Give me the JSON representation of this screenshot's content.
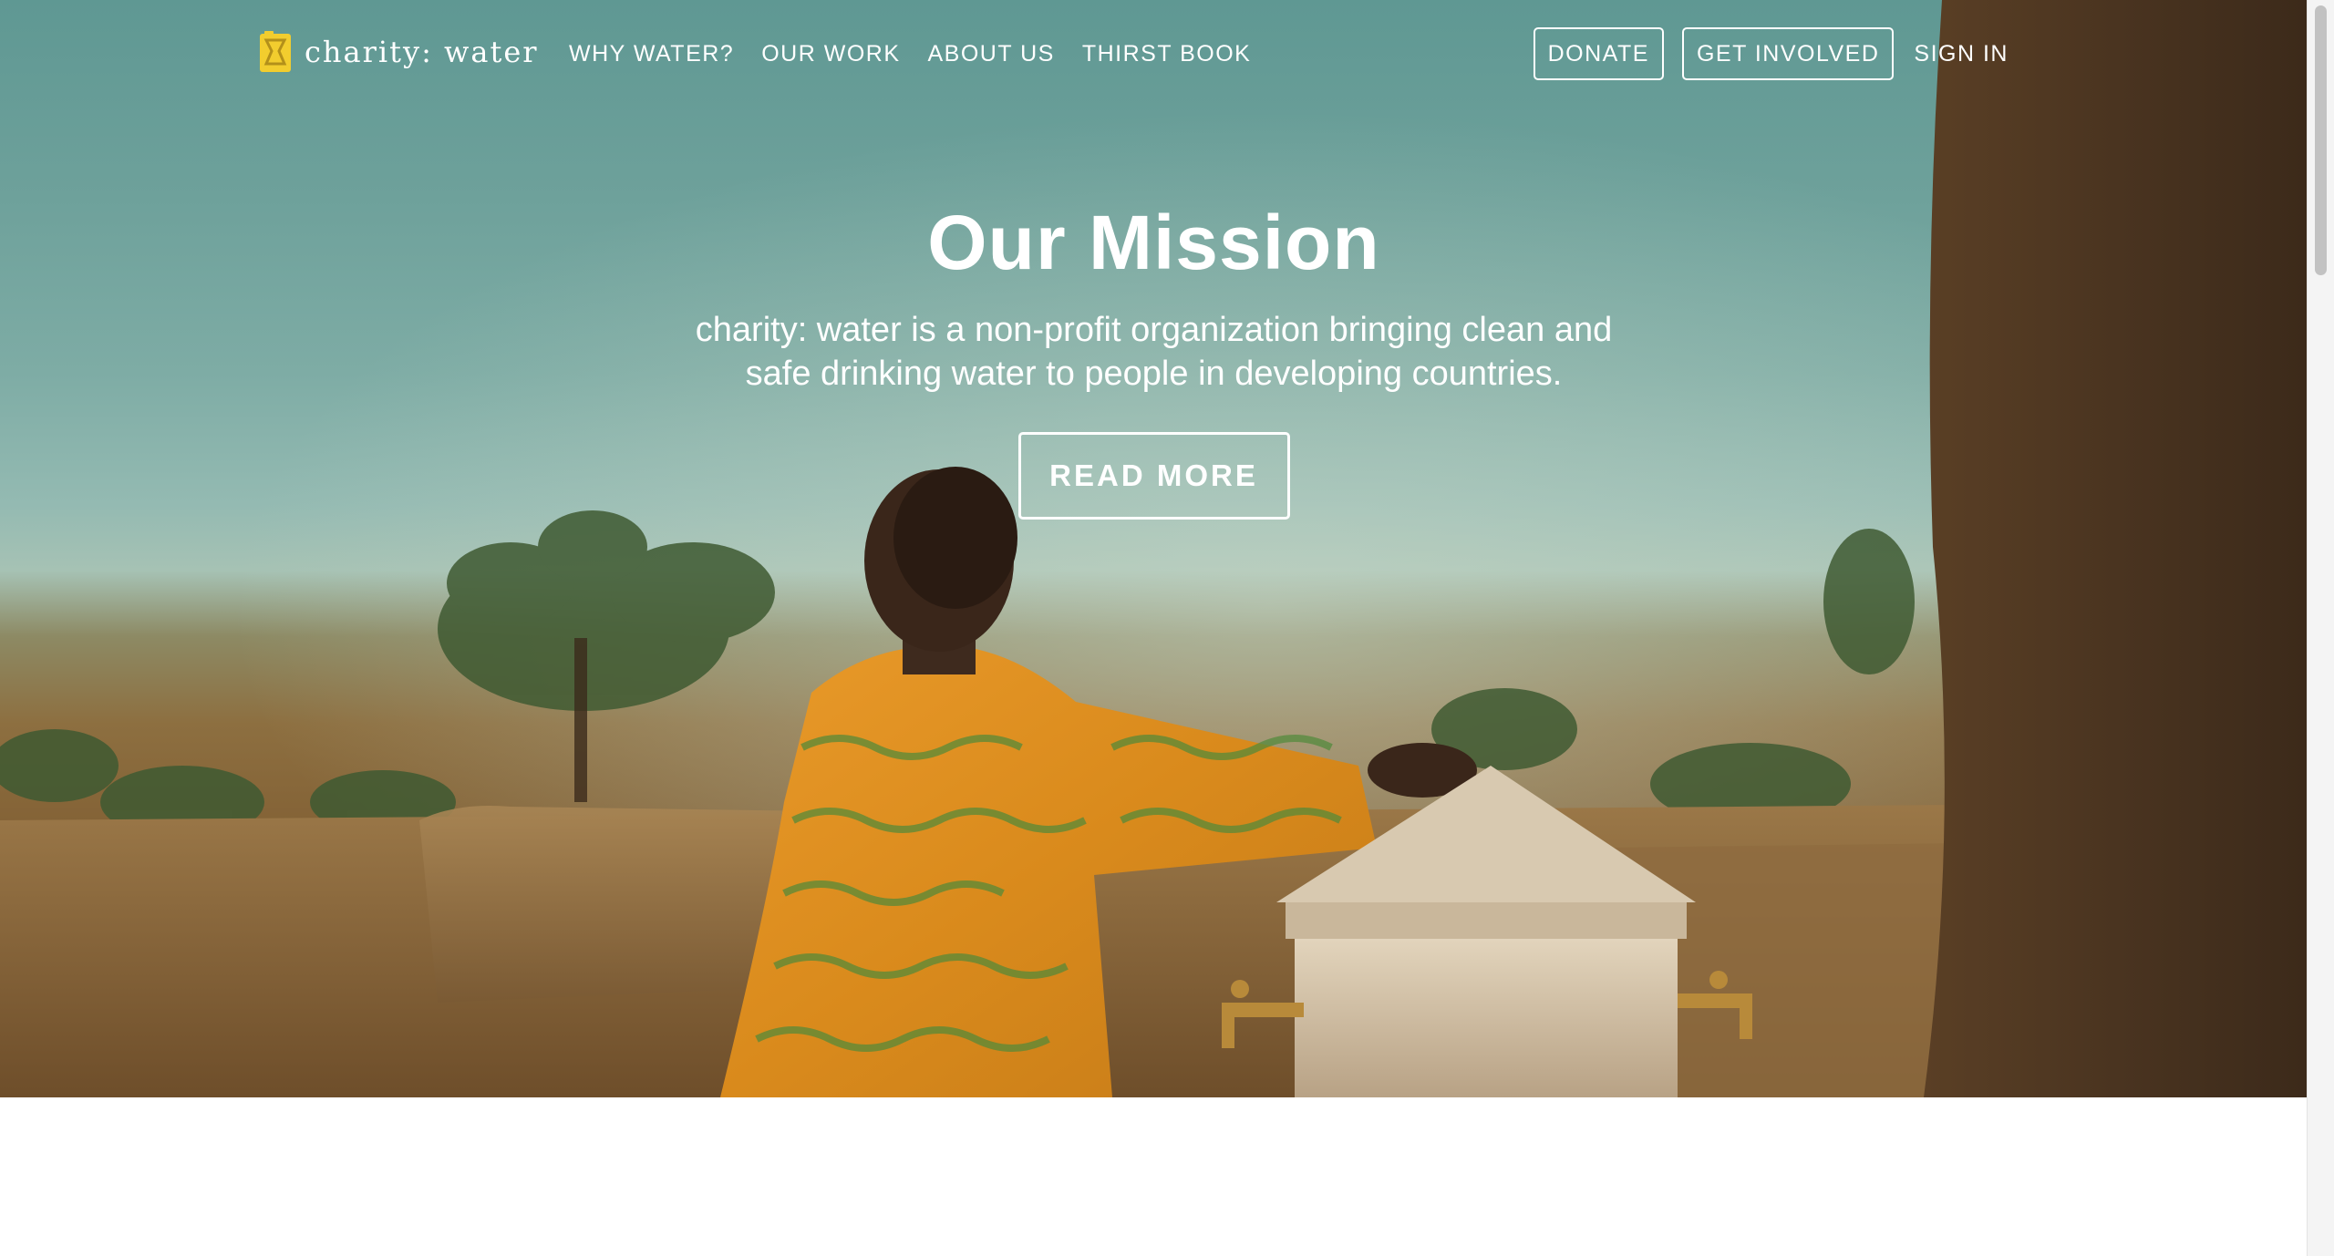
{
  "nav": {
    "logo_text": "charity: water",
    "logo_icon": "jerrycan-icon",
    "links": [
      "WHY WATER?",
      "OUR WORK",
      "ABOUT US",
      "THIRST BOOK"
    ],
    "donate_label": "DONATE",
    "get_involved_label": "GET INVOLVED",
    "sign_in_label": "SIGN IN"
  },
  "hero": {
    "title": "Our Mission",
    "subtitle": "charity: water is a non-profit organization bringing clean and safe drinking water to people in developing countries.",
    "cta_label": "READ MORE"
  },
  "colors": {
    "logo_yellow": "#f2cd2e",
    "sky": "#6ea19b",
    "text": "#ffffff"
  }
}
